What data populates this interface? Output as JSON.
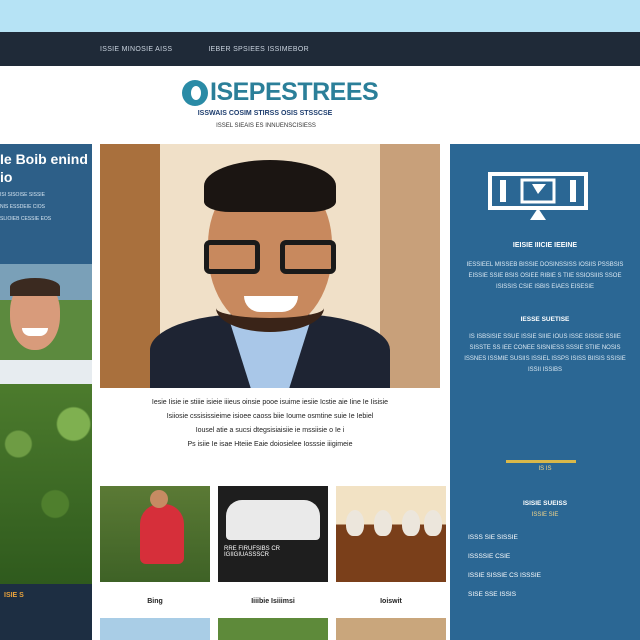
{
  "nav": {
    "links": [
      "ISSIE MINOSIE AISS",
      "IEBER SPSIEES ISSIMEBOR"
    ]
  },
  "header": {
    "logo_text": "ISEPESTREES",
    "tagline": "ISSWAIS COSIM STIRSS OSIS STSSCSE",
    "subtag": "ISSEL SIEAIS ES INNUENSCISIESS"
  },
  "left": {
    "promo_title": "Ie Boib enind io",
    "promo_lines": [
      "ISI SISOISE SISSIE",
      "NIS ESSDEIE CIOS",
      "SLIOIEB CESSIE EOS"
    ],
    "footer_label": "ISIE S"
  },
  "center": {
    "hero_text": [
      "Iesie Iisie ie stiiie isieie iiieus oinsie pooe isuime iesiie Icstie aie Iine Ie Iisisie",
      "Isiiosie cssisissieime isioee caoss biie Ioume osmtine suie Ie Iebiel",
      "Iousel atie a sucsi dtegsisiaisiie ie mssiisie o Ie i",
      "Ps isiie Ie isae Hteiie Eaie doiosielee Iosssie iiigimeie"
    ],
    "thumbs": [
      {
        "caption": ""
      },
      {
        "caption": "RRE FIRUFSIBS CR IGIIGIUASSSCR"
      },
      {
        "caption": ""
      }
    ],
    "thumb_labels": [
      "Bing",
      "Iiiibie Isiiimsi",
      "Ioiswit"
    ]
  },
  "right": {
    "title": "IEISIE IIICIE IEEINE",
    "para1": "IESSIEEL MISSEB BISSIE DOSINSSISS IOSIIS PSSBSIS EISSIE SSIE BSIS OSIEE RIBIE S TIIE SSIOSIIIS SSOE ISISSIS CSIE ISBIS EIAES EISESIE",
    "sub1": "IESSE SUETISE",
    "para2": "IS ISBSISIE SSUE ISSIE SIIIE IOUS ISSE SISSIE SSIIE SISSTE SS IEE CONEE SISNIESS SSSIE STIIE NOSIS ISSNES ISSMIE SUSIIS ISSIEL ISSPS ISISS BIISIS SSISIE ISSII ISSIBS",
    "small": "IS IS",
    "sub2": "ISISIE SUEISS",
    "small2": "ISSIE SIE",
    "links": [
      "ISSS SIE SISSIE",
      "ISSSSIE CSIE",
      "ISSIE SISSIE CS ISSSIE",
      "SISE SSE ISSIS"
    ]
  },
  "colors": {
    "nav_bg": "#1f2a38",
    "right_bg": "#2b6794",
    "left_bg": "#2f5f86",
    "logo": "#2b7f99",
    "accent": "#d9b84a"
  }
}
